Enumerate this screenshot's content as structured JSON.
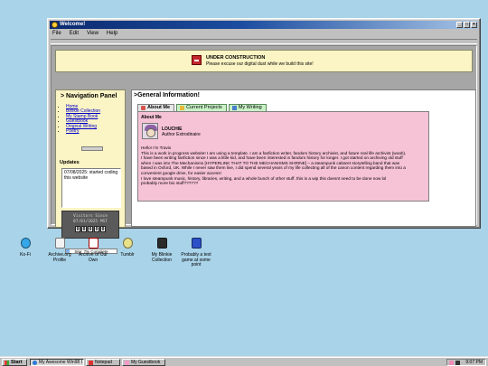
{
  "window": {
    "title": "Welcome!",
    "menu": [
      "File",
      "Edit",
      "View",
      "Help"
    ],
    "controls": [
      "_",
      "□",
      "×"
    ]
  },
  "banner": {
    "title": "UNDER CONSTRUCTION",
    "subtitle": "Please excuse our digital dust while we build this site!"
  },
  "sidebar": {
    "heading": "> Navigation Panel",
    "nav": [
      "Home",
      "Blinkie Collection",
      "My Stamp Book",
      "Guestbook",
      "Original Writing",
      "Poetry"
    ],
    "updates_heading": "Updates",
    "updates_text": "07/08/2025: started coding this website",
    "counter_line1": "Visitors Since",
    "counter_line2": "07/01/2025 MST",
    "counter_digits": [
      "0",
      "0",
      "0",
      "0",
      "0"
    ],
    "progress_label": "Site: 7% Complete",
    "progress_value": 0.07
  },
  "main": {
    "heading": ">General Information!",
    "tabs": [
      "About Me",
      "Current Projects",
      "My Writing"
    ],
    "about_heading": "About Me",
    "name": "LOUCHIE",
    "role": "Author Extrodinaire",
    "bio": [
      "Hello! I'm Travis",
      "This is a work in progress website! I am using a template. I am a fanfiction writer, fandom history archivist, and future real life archivist (woah).",
      "I have been writing fanfiction since I was a little kid, and have been interested in fandom history for longer. I got started on archiving old stuff",
      "when I was into The Mechanisms [HYPERLINK THAT TO THE MECHANISMS SHRINE] – a steampunk cabaret storytelling band that was",
      "based in Oxford, UK. While I never saw them live, I did spend several years of my life collecting all of the canon content regarding them into a",
      "convenient google drive, for easier access!",
      "I love steampunk music, history, libraries, writing, and a whole bunch of other stuff. this is a wip this doesnt need to be done now lol",
      "probably more bio stuff??????"
    ]
  },
  "desktop": {
    "icons": [
      {
        "label": "Ko-Fi",
        "icon": "kofi-icon",
        "color": "#35a7e8"
      },
      {
        "label": "Archive.org Profile",
        "icon": "archive-icon",
        "color": "#f2f2f2"
      },
      {
        "label": "Archive of Our Own",
        "icon": "ao3-icon",
        "color": "#ffffff"
      },
      {
        "label": "Tumblr",
        "icon": "tumblr-icon",
        "color": "#e9e08a"
      },
      {
        "label": "My Blinkie Collection",
        "icon": "blinkie-icon",
        "color": "#2a2a2a"
      },
      {
        "label": "Probably a text game at some point",
        "icon": "game-icon",
        "color": "#2b50c7"
      }
    ]
  },
  "taskbar": {
    "start": "Start",
    "items": [
      "My Awesome Win98 I",
      "Notepad",
      "My Guestbook"
    ],
    "clock": "9:07 PM"
  },
  "colors": {
    "desktop": "#a9d3e8",
    "banner": "#fbf4c4",
    "content_bg": "#f6c2d6",
    "tab_green": "#c9f2c7"
  }
}
